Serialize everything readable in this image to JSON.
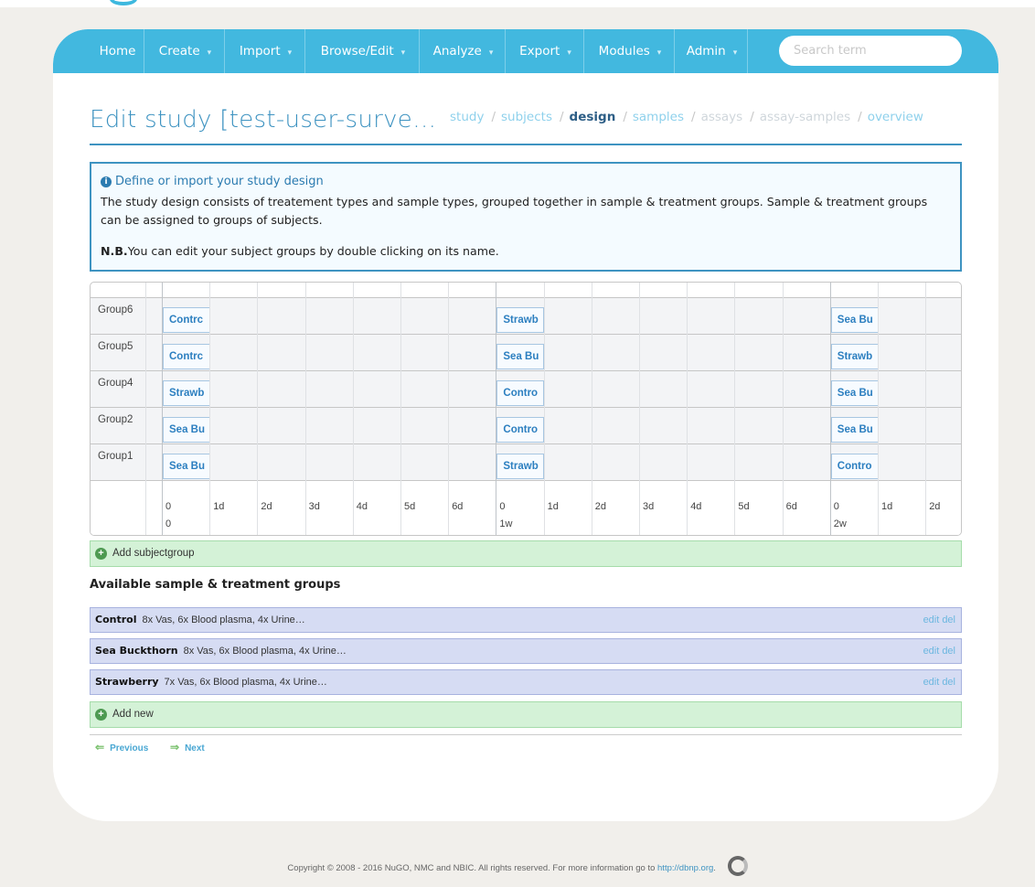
{
  "nav": {
    "items": [
      {
        "label": "Home",
        "caret": ""
      },
      {
        "label": "Create",
        "caret": "▾"
      },
      {
        "label": "Import",
        "caret": "▾"
      },
      {
        "label": "Browse/Edit",
        "caret": "▾"
      },
      {
        "label": "Analyze",
        "caret": "▾"
      },
      {
        "label": "Export",
        "caret": "▾"
      },
      {
        "label": "Modules",
        "caret": "▾"
      },
      {
        "label": "Admin",
        "caret": "▾"
      }
    ],
    "search_placeholder": "Search term"
  },
  "page": {
    "title": "Edit study [test-user-surve…",
    "steps": [
      {
        "label": "study",
        "state": "link"
      },
      {
        "label": "subjects",
        "state": "link"
      },
      {
        "label": "design",
        "state": "active"
      },
      {
        "label": "samples",
        "state": "link"
      },
      {
        "label": "assays",
        "state": "muted"
      },
      {
        "label": "assay-samples",
        "state": "muted"
      },
      {
        "label": "overview",
        "state": "link"
      }
    ],
    "step_separator": "/"
  },
  "info": {
    "heading": "Define or import your study design",
    "body": "The study design consists of treatement types and sample types, grouped together in sample & treatment groups. Sample & treatment groups can be assigned to groups of subjects.",
    "nb_label": "N.B.",
    "nb_text": "You can edit your subject groups by double clicking on its name."
  },
  "timeline": {
    "groups": [
      {
        "name": "Group6",
        "events": [
          "Contrc",
          "Strawb",
          "Sea Bu"
        ]
      },
      {
        "name": "Group5",
        "events": [
          "Contrc",
          "Sea Bu",
          "Strawb"
        ]
      },
      {
        "name": "Group4",
        "events": [
          "Strawb",
          "Contro",
          "Sea Bu"
        ]
      },
      {
        "name": "Group2",
        "events": [
          "Sea Bu",
          "Contro",
          "Sea Bu"
        ]
      },
      {
        "name": "Group1",
        "events": [
          "Sea Bu",
          "Strawb",
          "Contro"
        ]
      }
    ],
    "day_ticks": [
      "0",
      "1d",
      "2d",
      "3d",
      "4d",
      "5d",
      "6d",
      "0",
      "1d",
      "2d",
      "3d",
      "4d",
      "5d",
      "6d",
      "0",
      "1d",
      "2d"
    ],
    "week_ticks": [
      "0",
      "1w",
      "2w"
    ]
  },
  "add_subjectgroup_label": "Add subjectgroup",
  "available_title": "Available sample & treatment groups",
  "sample_groups": [
    {
      "name": "Control",
      "desc": "8x Vas, 6x Blood plasma, 4x Urine…"
    },
    {
      "name": "Sea Buckthorn",
      "desc": "8x Vas, 6x Blood plasma, 4x Urine…"
    },
    {
      "name": "Strawberry",
      "desc": "7x Vas, 6x Blood plasma, 4x Urine…"
    }
  ],
  "group_actions": {
    "edit": "edit",
    "del": "del"
  },
  "add_new_label": "Add new",
  "pager": {
    "previous": "Previous",
    "next": "Next"
  },
  "footer": {
    "text": "Copyright © 2008 - 2016 NuGO, NMC and NBIC. All rights reserved. For more information go to ",
    "link": "http://dbnp.org",
    "after": "."
  },
  "colors": {
    "accent": "#42b8df",
    "title": "#3e93c1",
    "green_bar": "#d4f2d7",
    "group_bar": "#d6dcf3"
  }
}
